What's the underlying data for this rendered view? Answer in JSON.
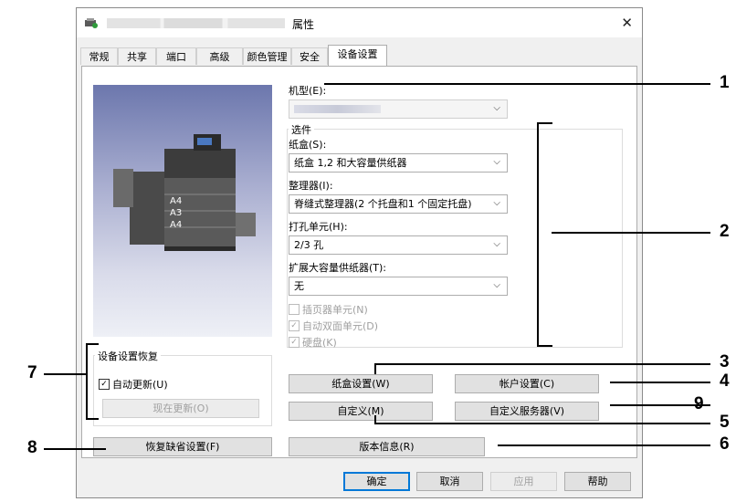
{
  "window": {
    "title": "属性",
    "close_glyph": "✕"
  },
  "tabs": [
    {
      "label": "常规"
    },
    {
      "label": "共享"
    },
    {
      "label": "端口"
    },
    {
      "label": "高级"
    },
    {
      "label": "颜色管理"
    },
    {
      "label": "安全"
    },
    {
      "label": "设备设置"
    }
  ],
  "printer_image": {
    "tray_labels": [
      "A4",
      "A3",
      "A4"
    ]
  },
  "model": {
    "label": "机型(E):"
  },
  "options": {
    "title": "选件",
    "drawer": {
      "label": "纸盒(S):",
      "value": "纸盒 1,2 和大容量供纸器"
    },
    "finisher": {
      "label": "整理器(I):",
      "value": "脊缝式整理器(2 个托盘和1 个固定托盘)"
    },
    "hole_punch": {
      "label": "打孔单元(H):",
      "value": "2/3 孔"
    },
    "ext_lcf": {
      "label": "扩展大容量供纸器(T):",
      "value": "无"
    },
    "inserter": {
      "label": "插页器单元(N)",
      "checked": false
    },
    "duplex": {
      "label": "自动双面单元(D)",
      "checked": true
    },
    "hdd": {
      "label": "硬盘(K)",
      "checked": true
    }
  },
  "restore": {
    "title": "设备设置恢复",
    "auto_update": {
      "label": "自动更新(U)",
      "checked": true
    },
    "update_now_button": "现在更新(O)"
  },
  "buttons": {
    "drawer_settings": "纸盒设置(W)",
    "account_settings": "帐户设置(C)",
    "customize": "自定义(M)",
    "custom_server": "自定义服务器(V)",
    "version_info": "版本信息(R)",
    "restore_defaults": "恢复缺省设置(F)"
  },
  "footer": {
    "ok": "确定",
    "cancel": "取消",
    "apply": "应用",
    "help": "帮助"
  },
  "callouts": [
    "1",
    "2",
    "3",
    "4",
    "5",
    "6",
    "7",
    "8",
    "9"
  ],
  "colors": {
    "accent": "#0078d7",
    "window_bg": "#f0f0f0"
  }
}
